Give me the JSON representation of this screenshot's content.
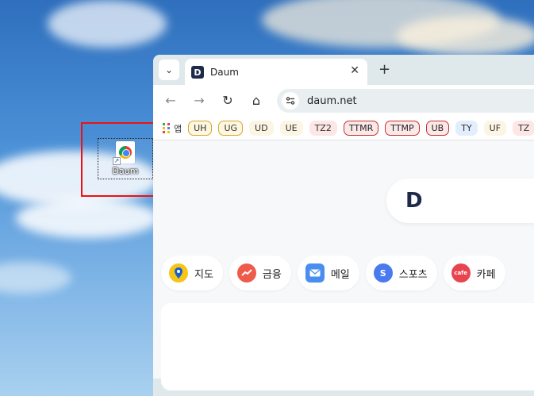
{
  "desktop": {
    "icon_label": "Daum"
  },
  "browser": {
    "tab": {
      "title": "Daum",
      "favicon_letter": "D"
    },
    "new_tab_symbol": "+",
    "tab_close_symbol": "✕",
    "tab_search_symbol": "⌄",
    "url": "daum.net",
    "nav": {
      "back": "←",
      "forward": "→",
      "reload": "↻",
      "home": "⌂"
    },
    "bookmarks": {
      "apps_label": "앱",
      "items": [
        "UH",
        "UG",
        "UD",
        "UE",
        "TZ2",
        "TTMR",
        "TTMP",
        "UB",
        "TY",
        "UF",
        "TZ"
      ]
    }
  },
  "page": {
    "logo_letter": "D",
    "shortcuts": [
      {
        "label": "지도",
        "icon": "map-pin-icon",
        "color": "#f5c518"
      },
      {
        "label": "금융",
        "icon": "finance-chart-icon",
        "color": "#f05a4a"
      },
      {
        "label": "메일",
        "icon": "mail-icon",
        "color": "#4a8df0"
      },
      {
        "label": "스포츠",
        "icon": "sports-icon",
        "color": "#4a7af0"
      },
      {
        "label": "카페",
        "icon": "cafe-icon",
        "color": "#e84450"
      }
    ]
  },
  "colors": {
    "highlight": "#ee1111",
    "daum_navy": "#1e2a4a"
  }
}
